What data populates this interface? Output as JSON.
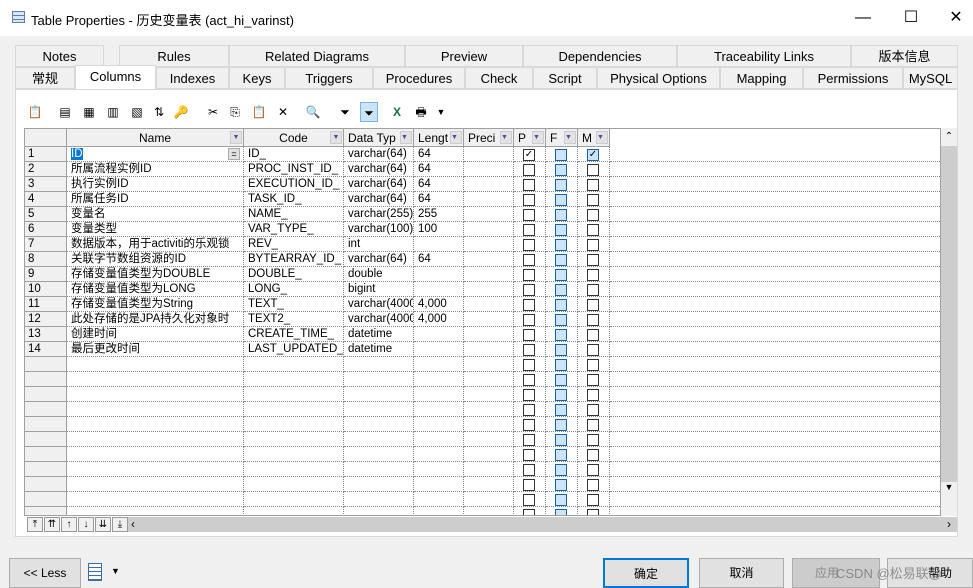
{
  "window": {
    "title": "Table Properties - 历史变量表 (act_hi_varinst)",
    "minimize": "—",
    "maximize": "☐",
    "close": "✕"
  },
  "tabs_row1": [
    "Notes",
    "Rules",
    "Related Diagrams",
    "Preview",
    "Dependencies",
    "Traceability Links",
    "版本信息"
  ],
  "tabs_row2": [
    "常规",
    "Columns",
    "Indexes",
    "Keys",
    "Triggers",
    "Procedures",
    "Check",
    "Script",
    "Physical Options",
    "Mapping",
    "Permissions",
    "MySQL"
  ],
  "active_tab": "Columns",
  "toolbar_icons": [
    "properties-icon",
    "insert-row-icon",
    "add-row-icon",
    "add-columns-icon",
    "reuse-columns-icon",
    "sort-icon",
    "key-icon",
    "cut-icon",
    "copy-icon",
    "paste-icon",
    "delete-icon",
    "find-icon",
    "customize-filter-icon",
    "enable-filter-icon",
    "excel-export-icon",
    "print-icon"
  ],
  "grid": {
    "headers": [
      "Name",
      "Code",
      "Data Typ",
      "Lengt",
      "Preci",
      "P",
      "F",
      "M"
    ],
    "rows": [
      {
        "n": "1",
        "name": "ID",
        "code": "ID_",
        "type": "varchar(64)",
        "len": "64",
        "p": true,
        "m": true
      },
      {
        "n": "2",
        "name": "所属流程实例ID",
        "code": "PROC_INST_ID_",
        "type": "varchar(64)",
        "len": "64",
        "p": false,
        "m": false
      },
      {
        "n": "3",
        "name": "执行实例ID",
        "code": "EXECUTION_ID_",
        "type": "varchar(64)",
        "len": "64",
        "p": false,
        "m": false
      },
      {
        "n": "4",
        "name": "所属任务ID",
        "code": "TASK_ID_",
        "type": "varchar(64)",
        "len": "64",
        "p": false,
        "m": false
      },
      {
        "n": "5",
        "name": "变量名",
        "code": "NAME_",
        "type": "varchar(255)",
        "len": "255",
        "p": false,
        "m": false
      },
      {
        "n": "6",
        "name": "变量类型",
        "code": "VAR_TYPE_",
        "type": "varchar(100)",
        "len": "100",
        "p": false,
        "m": false
      },
      {
        "n": "7",
        "name": "数据版本，用于activiti的乐观锁",
        "code": "REV_",
        "type": "int",
        "len": "",
        "p": false,
        "m": false
      },
      {
        "n": "8",
        "name": "关联字节数组资源的ID",
        "code": "BYTEARRAY_ID_",
        "type": "varchar(64)",
        "len": "64",
        "p": false,
        "m": false
      },
      {
        "n": "9",
        "name": "存储变量值类型为DOUBLE",
        "code": "DOUBLE_",
        "type": "double",
        "len": "",
        "p": false,
        "m": false
      },
      {
        "n": "10",
        "name": "存储变量值类型为LONG",
        "code": "LONG_",
        "type": "bigint",
        "len": "",
        "p": false,
        "m": false
      },
      {
        "n": "11",
        "name": "存储变量值类型为String",
        "code": "TEXT_",
        "type": "varchar(4000",
        "len": "4,000",
        "p": false,
        "m": false
      },
      {
        "n": "12",
        "name": "此处存储的是JPA持久化对象时",
        "code": "TEXT2_",
        "type": "varchar(4000",
        "len": "4,000",
        "p": false,
        "m": false
      },
      {
        "n": "13",
        "name": "创建时间",
        "code": "CREATE_TIME_",
        "type": "datetime",
        "len": "",
        "p": false,
        "m": false
      },
      {
        "n": "14",
        "name": "最后更改时间",
        "code": "LAST_UPDATED_",
        "type": "datetime",
        "len": "",
        "p": false,
        "m": false
      }
    ],
    "ellipsis": "="
  },
  "nav": [
    "⤒",
    "⇈",
    "↑",
    "↓",
    "⇊",
    "⤓"
  ],
  "footer": {
    "less": "<< Less",
    "ok": "确定",
    "cancel": "取消",
    "apply": "应用",
    "help": "帮助"
  },
  "watermark": "CSDN @松易联@",
  "colors": {
    "accent": "#0078d7",
    "selection": "#0078d7",
    "fk_checkbox": "#cce4f7"
  }
}
